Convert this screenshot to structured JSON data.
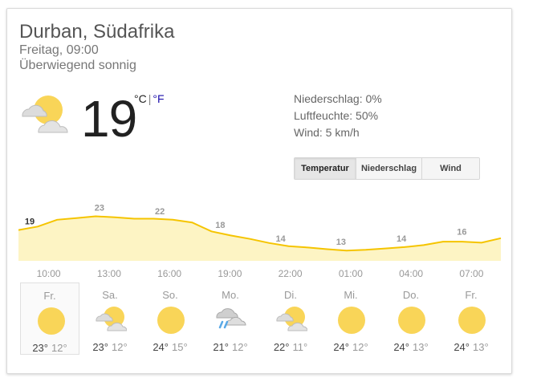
{
  "header": {
    "location": "Durban, Südafrika",
    "datetime": "Freitag, 09:00",
    "condition": "Überwiegend sonnig"
  },
  "current": {
    "temp": "19",
    "icon": "partly-cloudy-icon",
    "unit_c": "°C",
    "unit_sep": "|",
    "unit_f": "°F"
  },
  "details": {
    "precipitation": "Niederschlag: 0%",
    "humidity": "Luftfeuchte: 50%",
    "wind": "Wind: 5 km/h"
  },
  "tabs": [
    {
      "label": "Temperatur",
      "active": true
    },
    {
      "label": "Niederschlag",
      "active": false
    },
    {
      "label": "Wind",
      "active": false
    }
  ],
  "chart_data": {
    "type": "area",
    "x": [
      "10:00",
      "13:00",
      "16:00",
      "19:00",
      "22:00",
      "01:00",
      "04:00",
      "07:00"
    ],
    "labels": [
      "19",
      "23",
      "22",
      "18",
      "14",
      "13",
      "14",
      "16"
    ],
    "curve": [
      19,
      20,
      22,
      22.5,
      23,
      22.7,
      22.3,
      22.3,
      22,
      21.2,
      18.6,
      17.4,
      16.4,
      15.2,
      14.3,
      13.9,
      13.4,
      13,
      13.2,
      13.6,
      14,
      14.6,
      15.6,
      15.6,
      15.3,
      16.6
    ],
    "ylim": [
      10,
      25
    ],
    "colors": {
      "line": "#f5c400",
      "fill": "#fdf4c4"
    }
  },
  "forecast": [
    {
      "day": "Fr.",
      "icon": "sun-icon",
      "hi": "23°",
      "lo": "12°",
      "selected": true
    },
    {
      "day": "Sa.",
      "icon": "partly-cloudy-icon",
      "hi": "23°",
      "lo": "12°",
      "selected": false
    },
    {
      "day": "So.",
      "icon": "sun-icon",
      "hi": "24°",
      "lo": "15°",
      "selected": false
    },
    {
      "day": "Mo.",
      "icon": "rain-cloud-icon",
      "hi": "21°",
      "lo": "12°",
      "selected": false
    },
    {
      "day": "Di.",
      "icon": "partly-cloudy-icon",
      "hi": "22°",
      "lo": "11°",
      "selected": false
    },
    {
      "day": "Mi.",
      "icon": "sun-icon",
      "hi": "24°",
      "lo": "12°",
      "selected": false
    },
    {
      "day": "Do.",
      "icon": "sun-icon",
      "hi": "24°",
      "lo": "13°",
      "selected": false
    },
    {
      "day": "Fr.",
      "icon": "sun-icon",
      "hi": "24°",
      "lo": "13°",
      "selected": false
    }
  ]
}
